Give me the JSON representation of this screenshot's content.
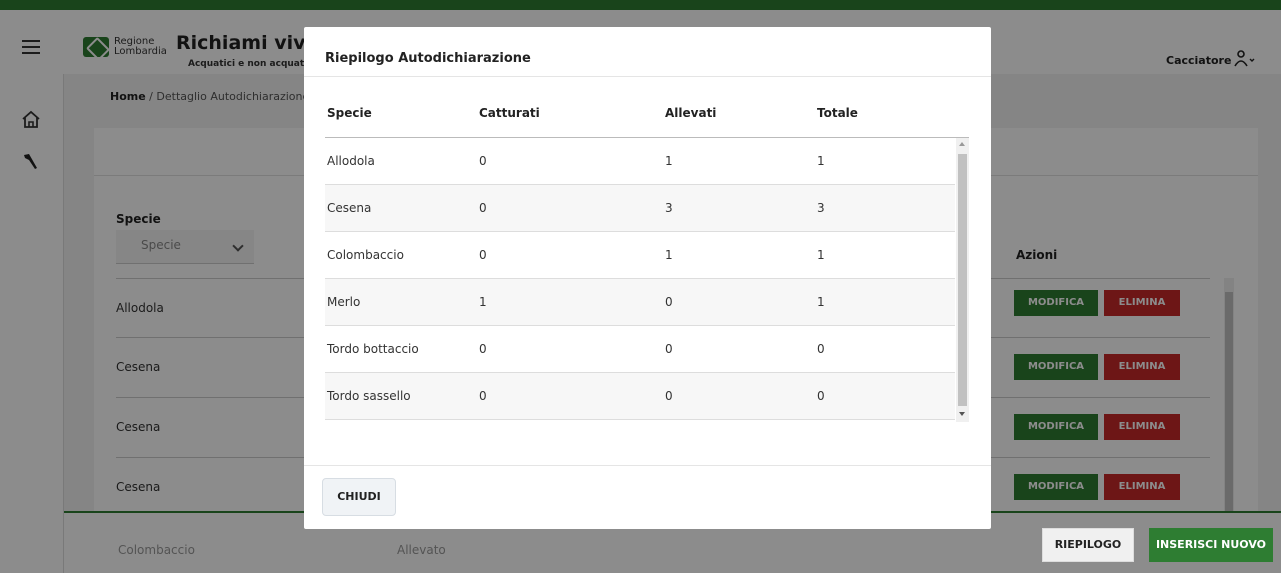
{
  "header": {
    "brand_line1": "Regione",
    "brand_line2": "Lombardia",
    "app_title": "Richiami vivi",
    "app_subtitle": "Acquatici e non acquatic",
    "user_label": "Cacciatore",
    "icons": [
      "menu-icon",
      "user-icon",
      "chevron-down-icon"
    ]
  },
  "sidebar": {
    "items": [
      {
        "icon": "home-icon"
      },
      {
        "icon": "bird-icon"
      }
    ]
  },
  "breadcrumb": {
    "home": "Home",
    "separator": " / ",
    "current": "Dettaglio Autodichiarazione"
  },
  "background_table": {
    "filter_label": "Specie",
    "filter_placeholder": "Specie",
    "actions_header": "Azioni",
    "rows": [
      {
        "specie": "Allodola",
        "modifica": "MODIFICA",
        "elimina": "ELIMINA"
      },
      {
        "specie": "Cesena",
        "modifica": "MODIFICA",
        "elimina": "ELIMINA"
      },
      {
        "specie": "Cesena",
        "modifica": "MODIFICA",
        "elimina": "ELIMINA"
      },
      {
        "specie": "Cesena",
        "modifica": "MODIFICA",
        "elimina": "ELIMINA"
      }
    ],
    "footer_row": {
      "specie": "Colombaccio",
      "tipo": "Allevato"
    }
  },
  "footer_actions": {
    "riepilogo": "RIEPILOGO",
    "inserisci": "INSERISCI NUOVO"
  },
  "modal": {
    "title": "Riepilogo Autodichiarazione",
    "columns": [
      "Specie",
      "Catturati",
      "Allevati",
      "Totale"
    ],
    "rows": [
      [
        "Allodola",
        "0",
        "1",
        "1"
      ],
      [
        "Cesena",
        "0",
        "3",
        "3"
      ],
      [
        "Colombaccio",
        "0",
        "1",
        "1"
      ],
      [
        "Merlo",
        "1",
        "0",
        "1"
      ],
      [
        "Tordo bottaccio",
        "0",
        "0",
        "0"
      ],
      [
        "Tordo sassello",
        "0",
        "0",
        "0"
      ]
    ],
    "close_label": "CHIUDI"
  },
  "colors": {
    "brand_green": "#2e7d32",
    "danger_red": "#c62828"
  }
}
